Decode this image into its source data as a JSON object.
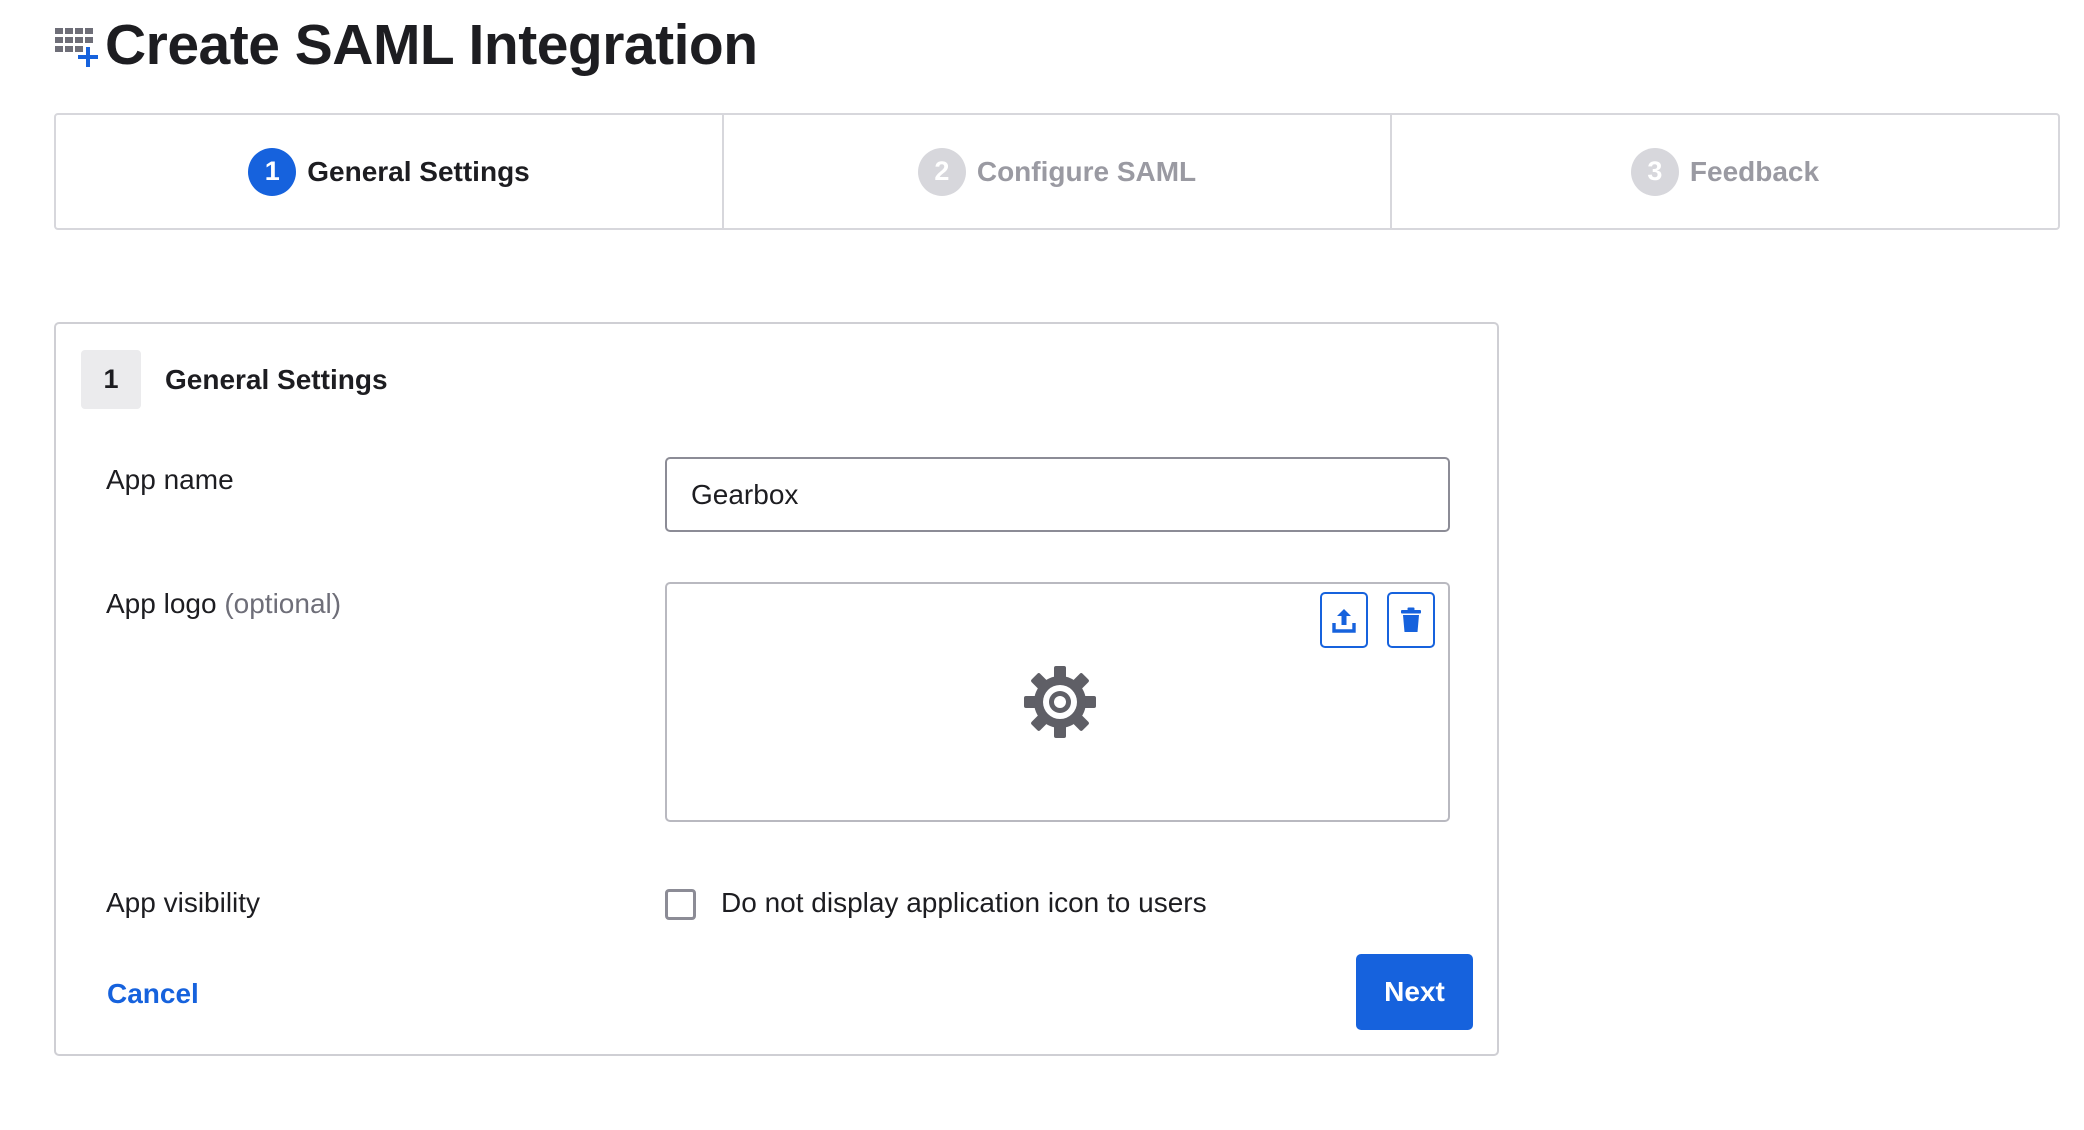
{
  "header": {
    "title": "Create SAML Integration",
    "icon": "app-add-icon"
  },
  "stepper": {
    "steps": [
      {
        "number": "1",
        "label": "General Settings",
        "state": "active"
      },
      {
        "number": "2",
        "label": "Configure SAML",
        "state": "inactive"
      },
      {
        "number": "3",
        "label": "Feedback",
        "state": "inactive"
      }
    ]
  },
  "card": {
    "section_number": "1",
    "section_title": "General Settings",
    "app_name": {
      "label": "App name",
      "value": "Gearbox"
    },
    "app_logo": {
      "label": "App logo",
      "optional": "(optional)",
      "preview_icon": "gear-icon",
      "upload_icon": "upload-icon",
      "delete_icon": "trash-icon"
    },
    "app_visibility": {
      "label": "App visibility",
      "checkbox_label": "Do not display application icon to users",
      "checked": false
    },
    "cancel_label": "Cancel",
    "next_label": "Next"
  },
  "colors": {
    "accent": "#1662dd",
    "step_inactive": "#d7d7dc",
    "text": "#1d1d21"
  }
}
